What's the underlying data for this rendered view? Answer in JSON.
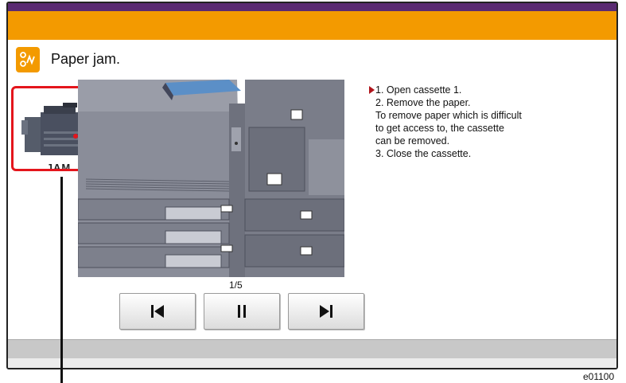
{
  "title": "Paper jam.",
  "jam_label": "JAM",
  "page_indicator": "1/5",
  "instructions": [
    "1. Open cassette 1.",
    "2. Remove the paper.",
    "To remove paper which is difficult",
    "to get access to, the cassette",
    "can be removed.",
    "3. Close the cassette."
  ],
  "controls": {
    "prev_icon": "skip-back-icon",
    "pause_icon": "pause-icon",
    "next_icon": "skip-forward-icon"
  },
  "doc_code": "e01100",
  "colors": {
    "accent_orange": "#f39a00",
    "top_band_purple": "#5a2a72",
    "jam_highlight_red": "#e4151c"
  }
}
